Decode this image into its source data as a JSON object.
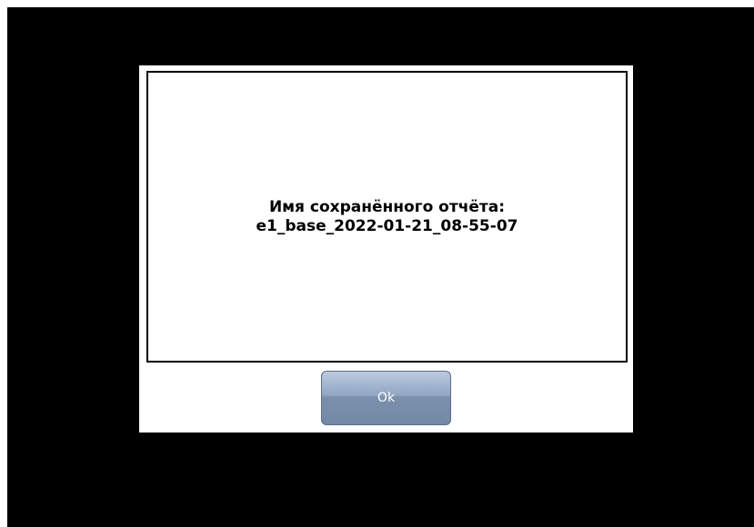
{
  "dialog": {
    "message_line1": "Имя сохранённого отчёта:",
    "message_line2": "e1_base_2022-01-21_08-55-07",
    "ok_label": "Ok"
  },
  "colors": {
    "screen_background": "#000000",
    "dialog_background": "#ffffff",
    "button_top": "#bccbe0",
    "button_bottom": "#7489a6",
    "button_text": "#ffffff"
  }
}
